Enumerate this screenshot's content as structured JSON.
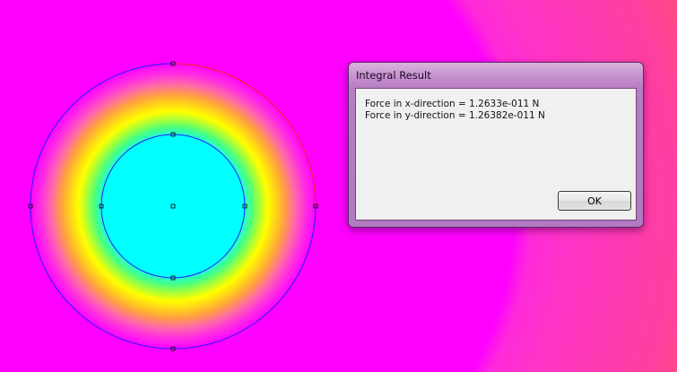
{
  "dialog": {
    "title": "Integral Result",
    "line_x": "Force in x-direction = 1.2633e-011 N",
    "line_y": "Force in y-direction = 1.26382e-011 N",
    "ok_label": "OK"
  },
  "colors": {
    "background_field": "#ff00ff",
    "inner_region": "#00ffff",
    "boundary_line": "#1f1fff",
    "selected_arc": "#ff2040",
    "node_marker": "#000000"
  }
}
